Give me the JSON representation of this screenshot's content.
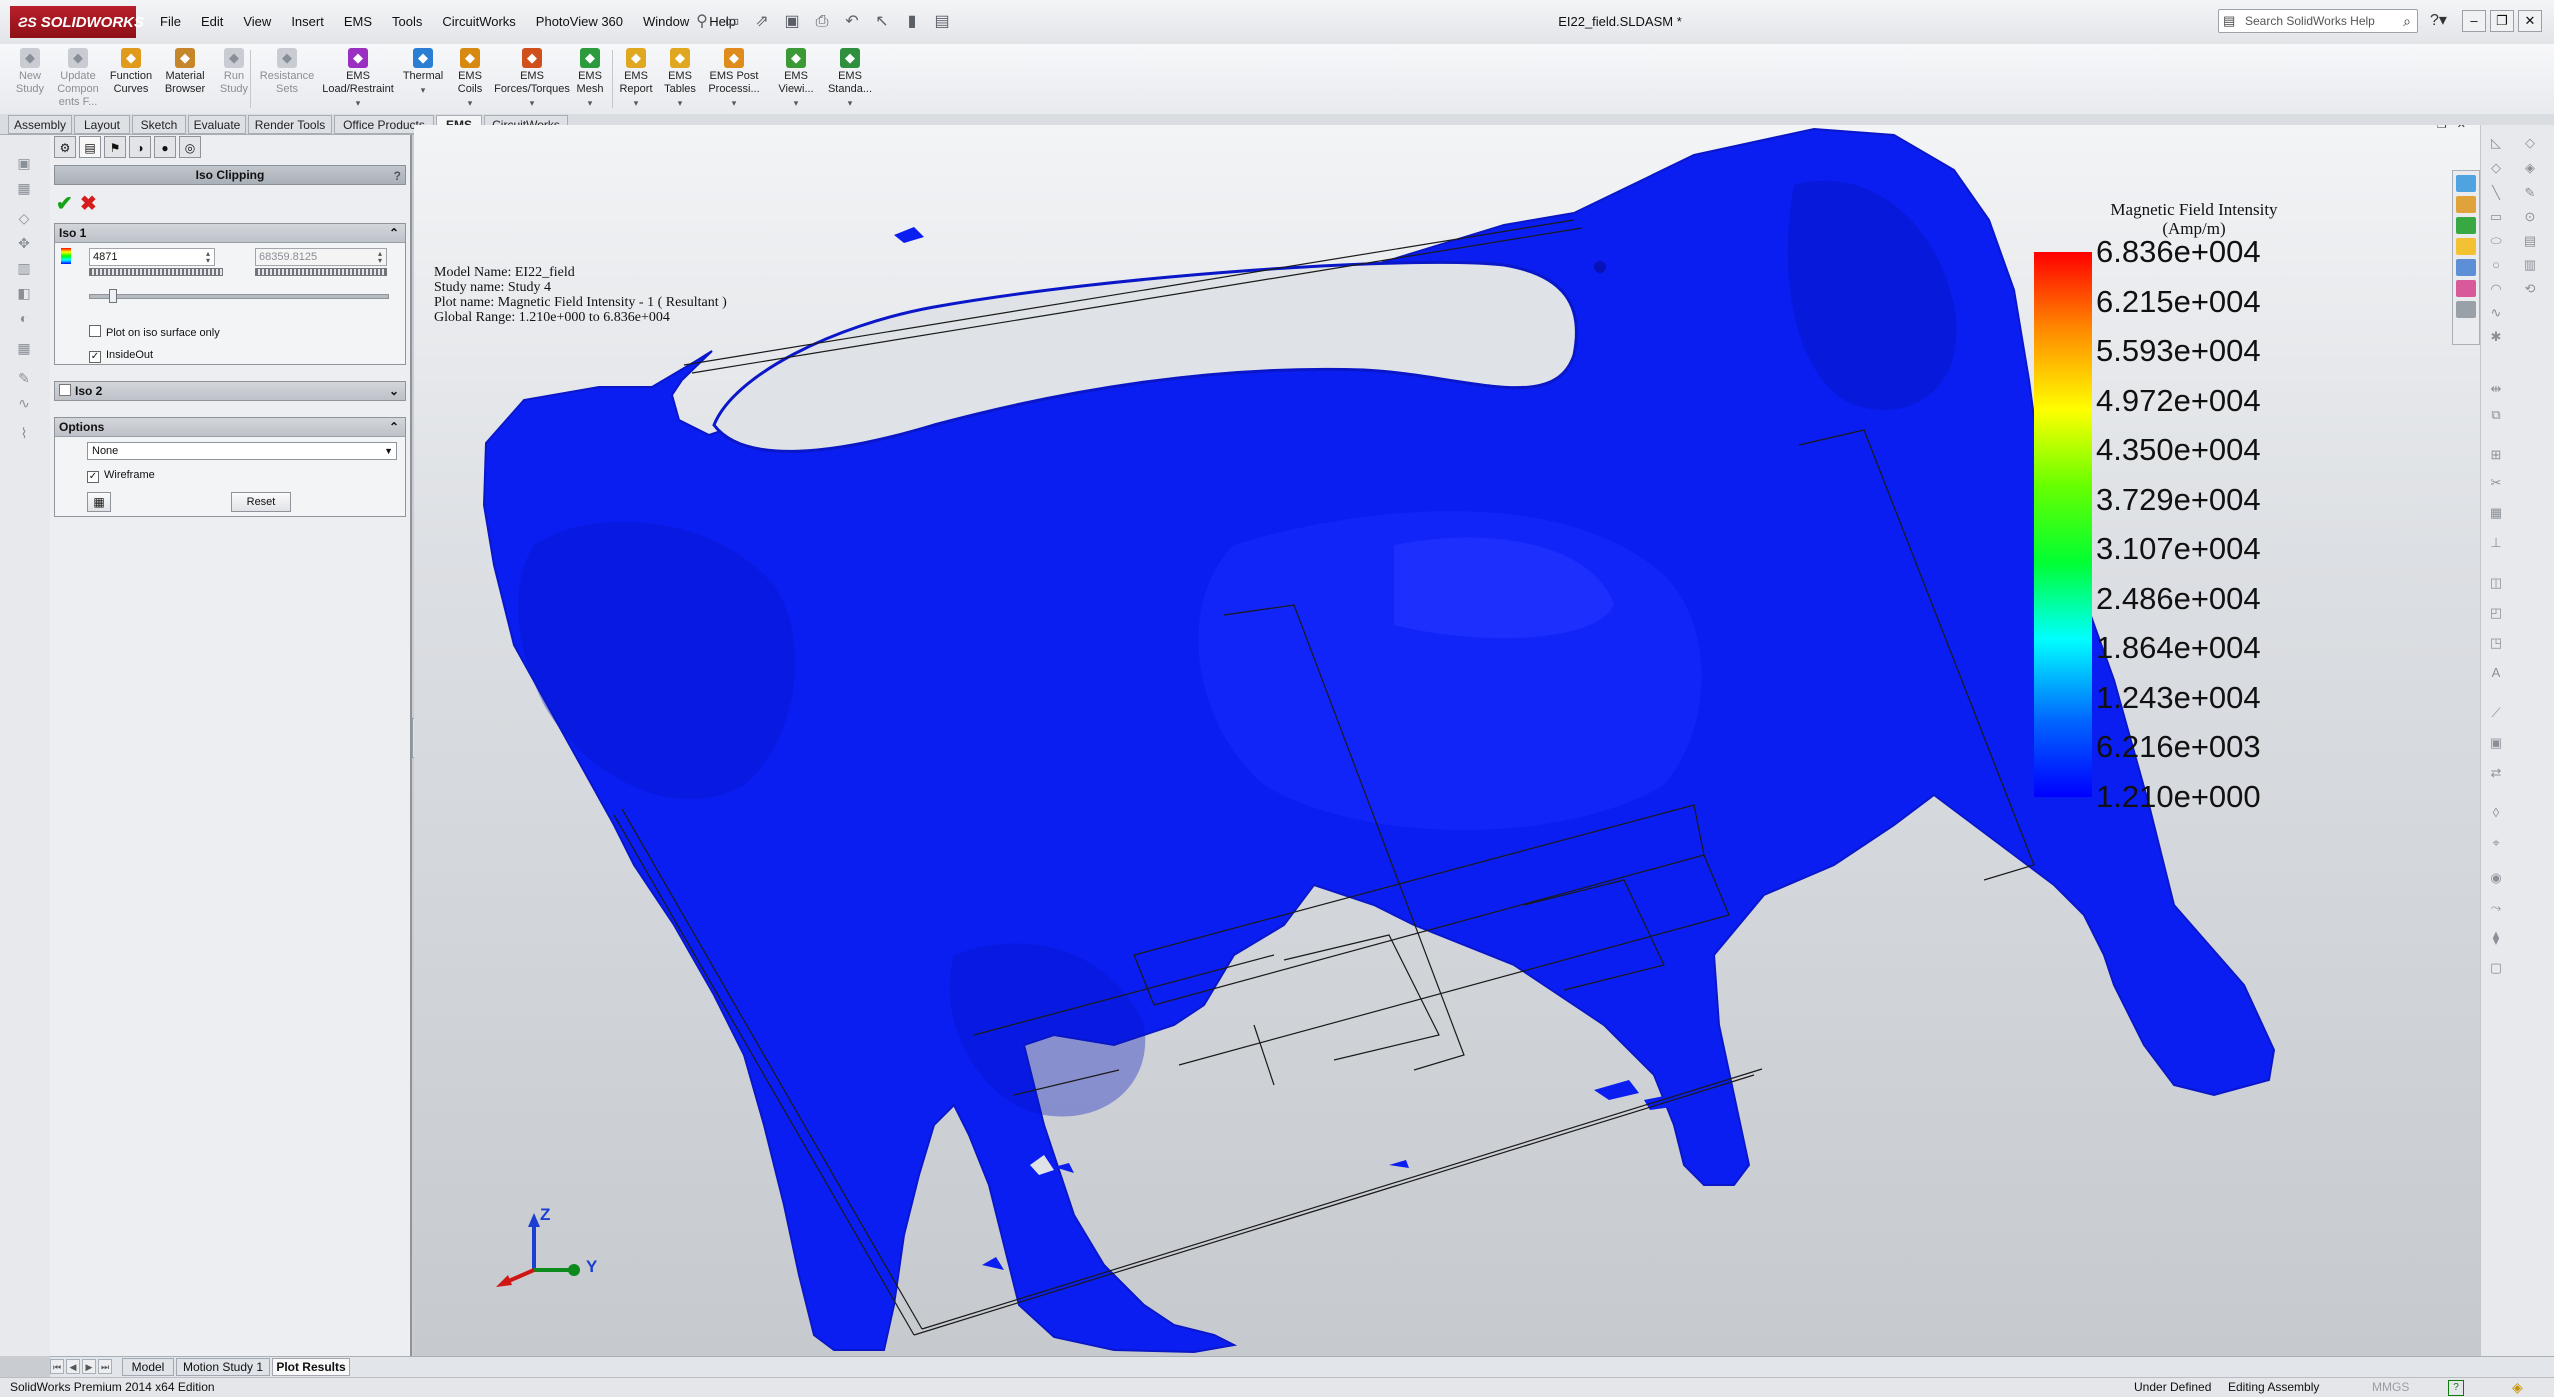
{
  "app": {
    "logo_text": "SOLIDWORKS",
    "document_title": "EI22_field.SLDASM *",
    "search_placeholder": "Search SolidWorks Help"
  },
  "menu": [
    "File",
    "Edit",
    "View",
    "Insert",
    "EMS",
    "Tools",
    "CircuitWorks",
    "PhotoView 360",
    "Window",
    "Help"
  ],
  "commands": [
    {
      "label": "New\nStudy",
      "icon": "new-study-icon",
      "enabled": false,
      "dropdown": false
    },
    {
      "label": "Update\nCompon\nents F...",
      "icon": "update-components-icon",
      "enabled": false,
      "dropdown": false
    },
    {
      "label": "Function\nCurves",
      "icon": "function-curves-icon",
      "enabled": true,
      "dropdown": false
    },
    {
      "label": "Material\nBrowser",
      "icon": "material-browser-icon",
      "enabled": true,
      "dropdown": false
    },
    {
      "label": "Run\nStudy",
      "icon": "run-study-icon",
      "enabled": false,
      "dropdown": false
    },
    {
      "label": "Resistance\nSets",
      "icon": "resistance-sets-icon",
      "enabled": false,
      "dropdown": false
    },
    {
      "label": "EMS\nLoad/Restraint",
      "icon": "load-restraint-icon",
      "enabled": true,
      "dropdown": true
    },
    {
      "label": "Thermal",
      "icon": "thermal-icon",
      "enabled": true,
      "dropdown": true
    },
    {
      "label": "EMS\nCoils",
      "icon": "coils-icon",
      "enabled": true,
      "dropdown": true
    },
    {
      "label": "EMS\nForces/Torques",
      "icon": "forces-torques-icon",
      "enabled": true,
      "dropdown": true
    },
    {
      "label": "EMS\nMesh",
      "icon": "mesh-icon",
      "enabled": true,
      "dropdown": true
    },
    {
      "label": "EMS\nReport",
      "icon": "report-icon",
      "enabled": true,
      "dropdown": true
    },
    {
      "label": "EMS\nTables",
      "icon": "tables-icon",
      "enabled": true,
      "dropdown": true
    },
    {
      "label": "EMS Post\nProcessi...",
      "icon": "post-processing-icon",
      "enabled": true,
      "dropdown": true
    },
    {
      "label": "EMS\nViewi...",
      "icon": "viewing-icon",
      "enabled": true,
      "dropdown": true
    },
    {
      "label": "EMS\nStanda...",
      "icon": "standard-icon",
      "enabled": true,
      "dropdown": true
    }
  ],
  "tabs": [
    "Assembly",
    "Layout",
    "Sketch",
    "Evaluate",
    "Render Tools",
    "Office Products",
    "EMS",
    "CircuitWorks"
  ],
  "active_tab": "EMS",
  "property_manager": {
    "title": "Iso Clipping",
    "iso1": {
      "title": "Iso 1",
      "value": "4871",
      "max_value": "68359.8125",
      "slider_fraction": 0.07,
      "plot_on_iso_surface_only": {
        "label": "Plot on iso surface only",
        "checked": false
      },
      "inside_out": {
        "label": "InsideOut",
        "checked": true
      }
    },
    "iso2": {
      "title": "Iso 2",
      "checked": false
    },
    "options": {
      "title": "Options",
      "selected": "None",
      "wireframe": {
        "label": "Wireframe",
        "checked": true
      },
      "reset_label": "Reset"
    }
  },
  "viewport": {
    "model_info": [
      "Model Name: EI22_field",
      "Study name: Study 4",
      "Plot name: Magnetic Field Intensity - 1 ( Resultant )",
      "Global Range: 1.210e+000 to 6.836e+004"
    ],
    "legend": {
      "title_line1": "Magnetic Field Intensity",
      "title_line2": "(Amp/m)",
      "ticks": [
        "6.836e+004",
        "6.215e+004",
        "5.593e+004",
        "4.972e+004",
        "4.350e+004",
        "3.729e+004",
        "3.107e+004",
        "2.486e+004",
        "1.864e+004",
        "1.243e+004",
        "6.216e+003",
        "1.210e+000"
      ],
      "colors": [
        "#ff0000",
        "#ff8800",
        "#ffff00",
        "#66ff00",
        "#00ff33",
        "#00ffff",
        "#0066ff",
        "#0000ff"
      ]
    },
    "triad": {
      "z": "Z",
      "y": "Y"
    },
    "surface_color": "#0a1ef2"
  },
  "bottom_tabs": [
    "Model",
    "Motion Study 1",
    "Plot Results"
  ],
  "active_bottom_tab": "Plot Results",
  "status": {
    "edition": "SolidWorks Premium 2014 x64 Edition",
    "definition": "Under Defined",
    "mode": "Editing Assembly",
    "units": "MMGS"
  }
}
